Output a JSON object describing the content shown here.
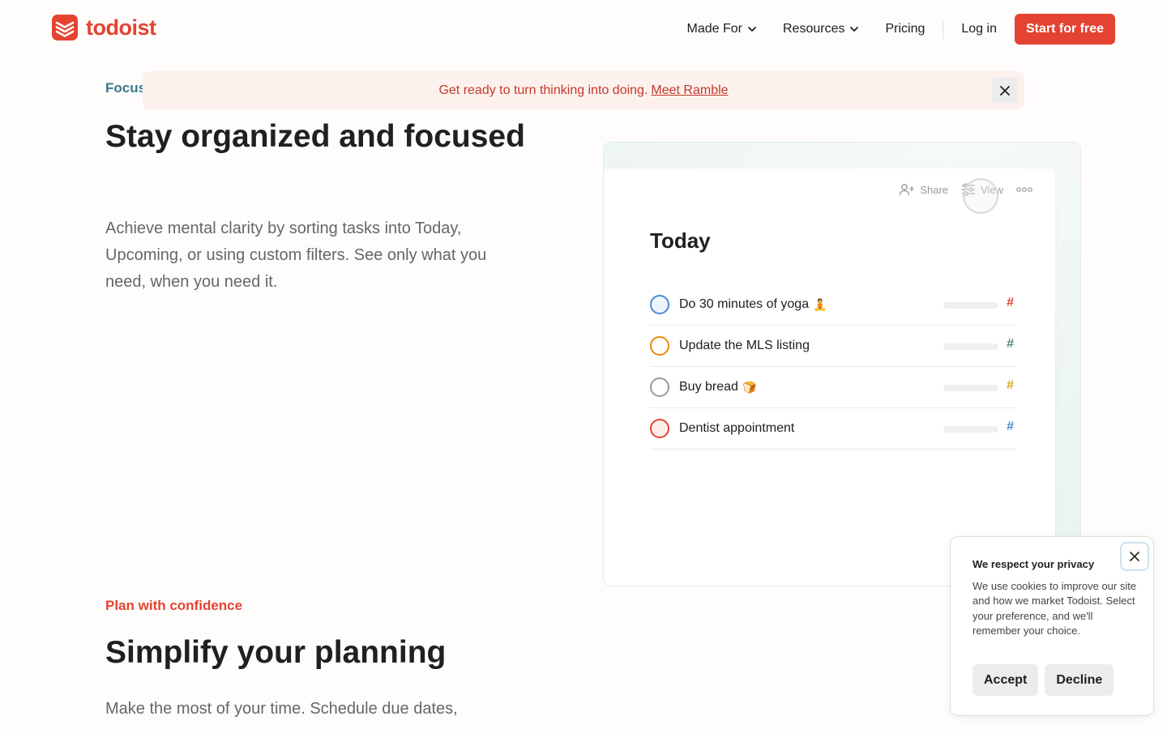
{
  "header": {
    "brand": "todoist",
    "nav": {
      "made_for": "Made For",
      "resources": "Resources",
      "pricing": "Pricing",
      "login": "Log in",
      "cta": "Start for free"
    }
  },
  "banner": {
    "text": "Get ready to turn thinking into doing.",
    "link": "Meet Ramble"
  },
  "focus_section": {
    "eyebrow": "Focus",
    "title": "Stay organized and focused",
    "lead": "Achieve mental clarity by sorting tasks into Today, Upcoming, or using custom filters. See only what you need, when you need it."
  },
  "app_preview": {
    "toolbar": {
      "share": "Share",
      "view": "View"
    },
    "title": "Today",
    "tasks": [
      {
        "label": "Do 30 minutes of yoga",
        "emoji": "🧘",
        "check_color": "#4a8ad3",
        "check_fill": "#eef4fb",
        "hash_color": "#e44332"
      },
      {
        "label": "Update the MLS listing",
        "emoji": "",
        "check_color": "#eb8909",
        "check_fill": "#ffffff",
        "hash_color": "#4f8a6b"
      },
      {
        "label": "Buy bread",
        "emoji": "🍞",
        "check_color": "#999999",
        "check_fill": "#ffffff",
        "hash_color": "#d9a51a"
      },
      {
        "label": "Dentist appointment",
        "emoji": "",
        "check_color": "#e44332",
        "check_fill": "#fdeeee",
        "hash_color": "#4a8ad3"
      }
    ]
  },
  "plan_section": {
    "eyebrow": "Plan with confidence",
    "title": "Simplify your planning",
    "lead": "Make the most of your time. Schedule due dates,"
  },
  "cookie": {
    "title": "We respect your privacy",
    "text": "We use cookies to improve our site and how we market Todoist. Select your preference, and we'll remember your choice.",
    "accept": "Accept",
    "decline": "Decline"
  },
  "colors": {
    "brand": "#e44332",
    "focus_eyebrow": "#3b7a8a",
    "banner_bg": "#fdf1ed"
  },
  "icons": [
    "todoist-logo-icon",
    "chevron-down-icon",
    "close-icon",
    "share-user-icon",
    "view-sliders-icon",
    "more-dots-icon",
    "hash-icon"
  ]
}
